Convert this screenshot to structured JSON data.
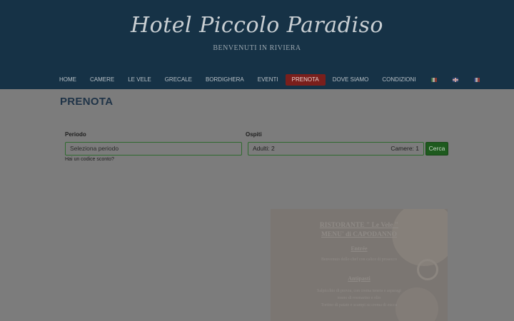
{
  "header": {
    "logo": "Hotel Piccolo Paradiso",
    "subtitle": "BENVENUTI IN RIVIERA"
  },
  "nav": {
    "items": [
      {
        "label": "HOME"
      },
      {
        "label": "CAMERE"
      },
      {
        "label": "LE VELE"
      },
      {
        "label": "GRECALE"
      },
      {
        "label": "BORDIGHERA"
      },
      {
        "label": "EVENTI"
      },
      {
        "label": "PRENOTA"
      },
      {
        "label": "DOVE SIAMO"
      },
      {
        "label": "CONDIZIONI"
      }
    ],
    "flags": [
      "italian-flag-icon",
      "uk-flag-icon",
      "french-flag-icon"
    ],
    "active_color": "#7a1f1c"
  },
  "page": {
    "title": "PRENOTA"
  },
  "booking": {
    "period_label": "Periodo",
    "period_placeholder": "Seleziona periodo",
    "guests_label": "Ospiti",
    "adults": "Adulti: 2",
    "rooms": "Camere: 1",
    "search_label": "Cerca",
    "discount_link": "Hai un codice sconto?",
    "accent_color": "#1e5a1e"
  },
  "menu_card": {
    "heading_line1": "RISTORANTE \" Le Vele \"",
    "heading_line2": "MENU' di CAPODANNO",
    "section1": "Entrée",
    "section1_line": "Benvenuto dello chef con calice di prosecco",
    "section2": "Antipasti",
    "section2_line1": "Salpicchio di piovra, con crema tenera e asparagi",
    "section2_line2": "tonno di rosmarino e olio",
    "section2_line3": "Tortino di patate e scampi su crema di zucca"
  }
}
